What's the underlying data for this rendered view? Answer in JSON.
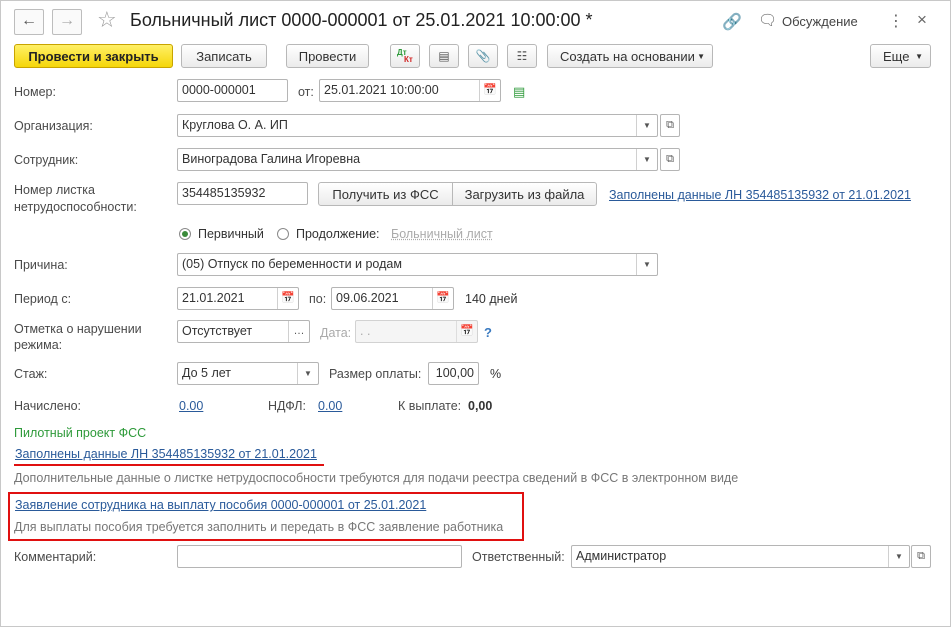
{
  "window": {
    "title": "Больничный лист 0000-000001 от 25.01.2021 10:00:00 *",
    "discussion_label": "Обсуждение"
  },
  "toolbar": {
    "post_close_label": "Провести и закрыть",
    "save_label": "Записать",
    "post_label": "Провести",
    "dt_label": "Дт",
    "kt_label": "Кт",
    "create_based_label": "Создать на основании",
    "more_label": "Еще"
  },
  "form": {
    "number_label": "Номер:",
    "number_value": "0000-000001",
    "date_label": "от:",
    "date_value": "25.01.2021 10:00:00",
    "org_label": "Организация:",
    "org_value": "Круглова О. А. ИП",
    "employee_label": "Сотрудник:",
    "employee_value": "Виноградова Галина Игоревна",
    "sheet_number_label_1": "Номер листка",
    "sheet_number_label_2": "нетрудоспособности:",
    "sheet_number_value": "354485135932",
    "get_fss_label": "Получить из ФСС",
    "load_file_label": "Загрузить из файла",
    "filled_link": "Заполнены данные ЛН 354485135932 от 21.01.2021",
    "primary_label": "Первичный",
    "continuation_label": "Продолжение:",
    "sick_leave_link": "Больничный лист",
    "reason_label": "Причина:",
    "reason_value": "(05) Отпуск по беременности и родам",
    "period_label": "Период с:",
    "period_from": "21.01.2021",
    "period_to_label": "по:",
    "period_to": "09.06.2021",
    "days_text": "140 дней",
    "violation_label_1": "Отметка о нарушении",
    "violation_label_2": "режима:",
    "violation_value": "Отсутствует",
    "violation_date_label": "Дата:",
    "violation_date_value": " .  .",
    "help_label": "?",
    "experience_label": "Стаж:",
    "experience_value": "До 5 лет",
    "pay_size_label": "Размер оплаты:",
    "pay_size_value": "100,00",
    "percent_label": "%",
    "accrued_label": "Начислено:",
    "accrued_value": "0.00",
    "ndfl_label": "НДФЛ:",
    "ndfl_value": "0.00",
    "to_pay_label": "К выплате:",
    "to_pay_value": "0,00",
    "pilot_label": "Пилотный проект ФСС",
    "pilot_filled_link": "Заполнены данные ЛН 354485135932 от 21.01.2021",
    "pilot_hint": "Дополнительные данные о листке нетрудоспособности требуются для подачи реестра сведений в ФСС в электронном виде",
    "application_link": "Заявление сотрудника на выплату пособия 0000-000001 от 25.01.2021",
    "application_hint": "Для выплаты пособия требуется заполнить и передать в ФСС заявление работника",
    "comment_label": "Комментарий:",
    "comment_value": "",
    "responsible_label": "Ответственный:",
    "responsible_value": "Администратор"
  },
  "colors": {
    "primary_button": "#f5d60a",
    "link": "#2a5a9a",
    "pilot_green": "#2e9a3a",
    "highlight_red": "#e01010"
  }
}
